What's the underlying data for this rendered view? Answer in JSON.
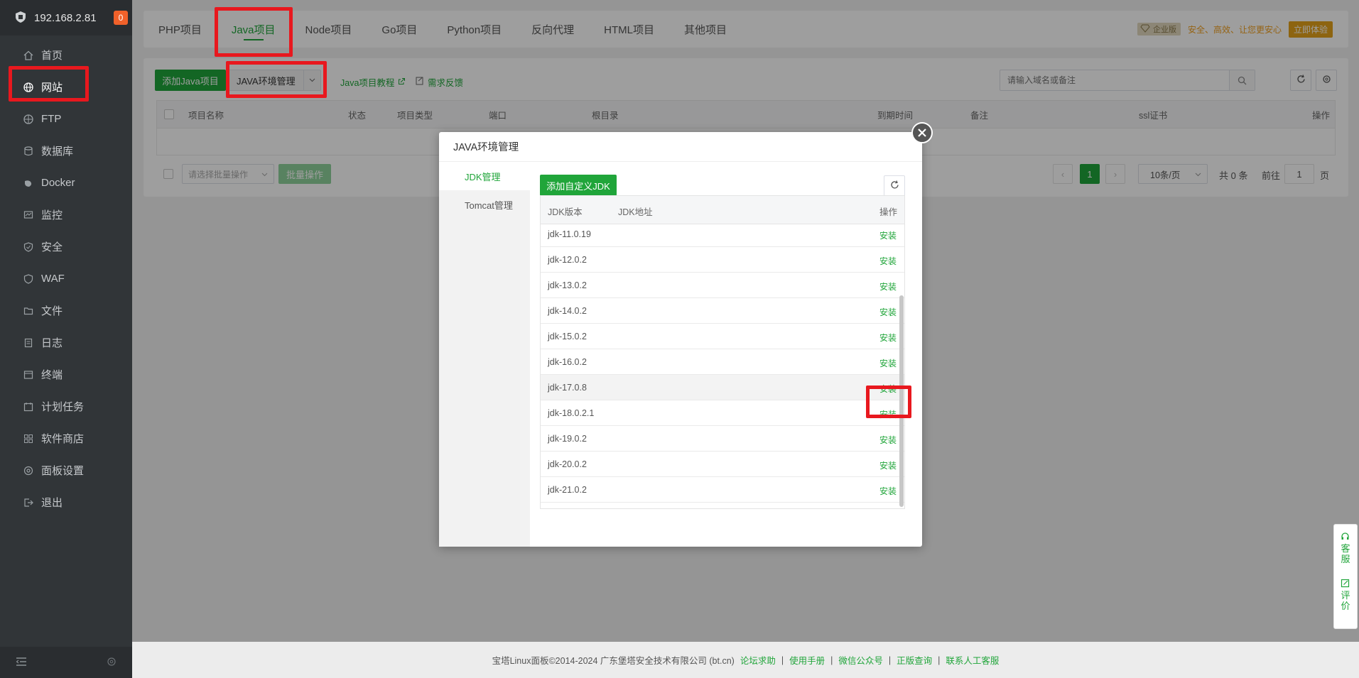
{
  "sidebar": {
    "ip": "192.168.2.81",
    "badge": "0",
    "items": [
      {
        "label": "首页",
        "icon": "home-icon"
      },
      {
        "label": "网站",
        "icon": "globe-icon"
      },
      {
        "label": "FTP",
        "icon": "ftp-icon"
      },
      {
        "label": "数据库",
        "icon": "database-icon"
      },
      {
        "label": "Docker",
        "icon": "docker-icon"
      },
      {
        "label": "监控",
        "icon": "monitor-icon"
      },
      {
        "label": "安全",
        "icon": "shield-icon"
      },
      {
        "label": "WAF",
        "icon": "waf-icon"
      },
      {
        "label": "文件",
        "icon": "folder-icon"
      },
      {
        "label": "日志",
        "icon": "log-icon"
      },
      {
        "label": "终端",
        "icon": "terminal-icon"
      },
      {
        "label": "计划任务",
        "icon": "cron-icon"
      },
      {
        "label": "软件商店",
        "icon": "store-icon"
      },
      {
        "label": "面板设置",
        "icon": "gear-icon"
      },
      {
        "label": "退出",
        "icon": "logout-icon"
      }
    ]
  },
  "topbar": {
    "tabs": [
      "PHP项目",
      "Java项目",
      "Node项目",
      "Go项目",
      "Python项目",
      "反向代理",
      "HTML项目",
      "其他项目"
    ],
    "promo_badge": "企业版",
    "promo_text": "安全、高效、让您更安心",
    "promo_button": "立即体验"
  },
  "toolbar": {
    "add_java": "添加Java项目",
    "java_env": "JAVA环境管理",
    "tutorial": "Java项目教程",
    "feedback": "需求反馈",
    "search_placeholder": "请输入域名或备注"
  },
  "table": {
    "headers": [
      "项目名称",
      "状态",
      "项目类型",
      "端口",
      "根目录",
      "到期时间",
      "备注",
      "ssl证书",
      "操作"
    ]
  },
  "batch": {
    "select_placeholder": "请选择批量操作",
    "button": "批量操作"
  },
  "pager": {
    "current": "1",
    "page_size": "10条/页",
    "total": "共 0 条",
    "goto_label": "前往",
    "goto_value": "1",
    "page_suffix": "页"
  },
  "modal": {
    "title": "JAVA环境管理",
    "tabs": [
      "JDK管理",
      "Tomcat管理"
    ],
    "add_button": "添加自定义JDK",
    "headers": {
      "version": "JDK版本",
      "path": "JDK地址",
      "action": "操作"
    },
    "rows": [
      {
        "version": "jdk-11.0.19",
        "action": "安装"
      },
      {
        "version": "jdk-12.0.2",
        "action": "安装"
      },
      {
        "version": "jdk-13.0.2",
        "action": "安装"
      },
      {
        "version": "jdk-14.0.2",
        "action": "安装"
      },
      {
        "version": "jdk-15.0.2",
        "action": "安装"
      },
      {
        "version": "jdk-16.0.2",
        "action": "安装"
      },
      {
        "version": "jdk-17.0.8",
        "action": "安装"
      },
      {
        "version": "jdk-18.0.2.1",
        "action": "安装"
      },
      {
        "version": "jdk-19.0.2",
        "action": "安装"
      },
      {
        "version": "jdk-20.0.2",
        "action": "安装"
      },
      {
        "version": "jdk-21.0.2",
        "action": "安装"
      }
    ]
  },
  "footer": {
    "copyright": "宝塔Linux面板©2014-2024 广东堡塔安全技术有限公司 (bt.cn)",
    "links": [
      "论坛求助",
      "使用手册",
      "微信公众号",
      "正版查询",
      "联系人工客服"
    ]
  },
  "float": {
    "service": [
      "客",
      "服"
    ],
    "review": [
      "评",
      "价"
    ]
  },
  "colors": {
    "accent": "#20a53a",
    "sidebar": "#313538",
    "annotation": "#e8181e",
    "promo": "#e4a21b"
  }
}
